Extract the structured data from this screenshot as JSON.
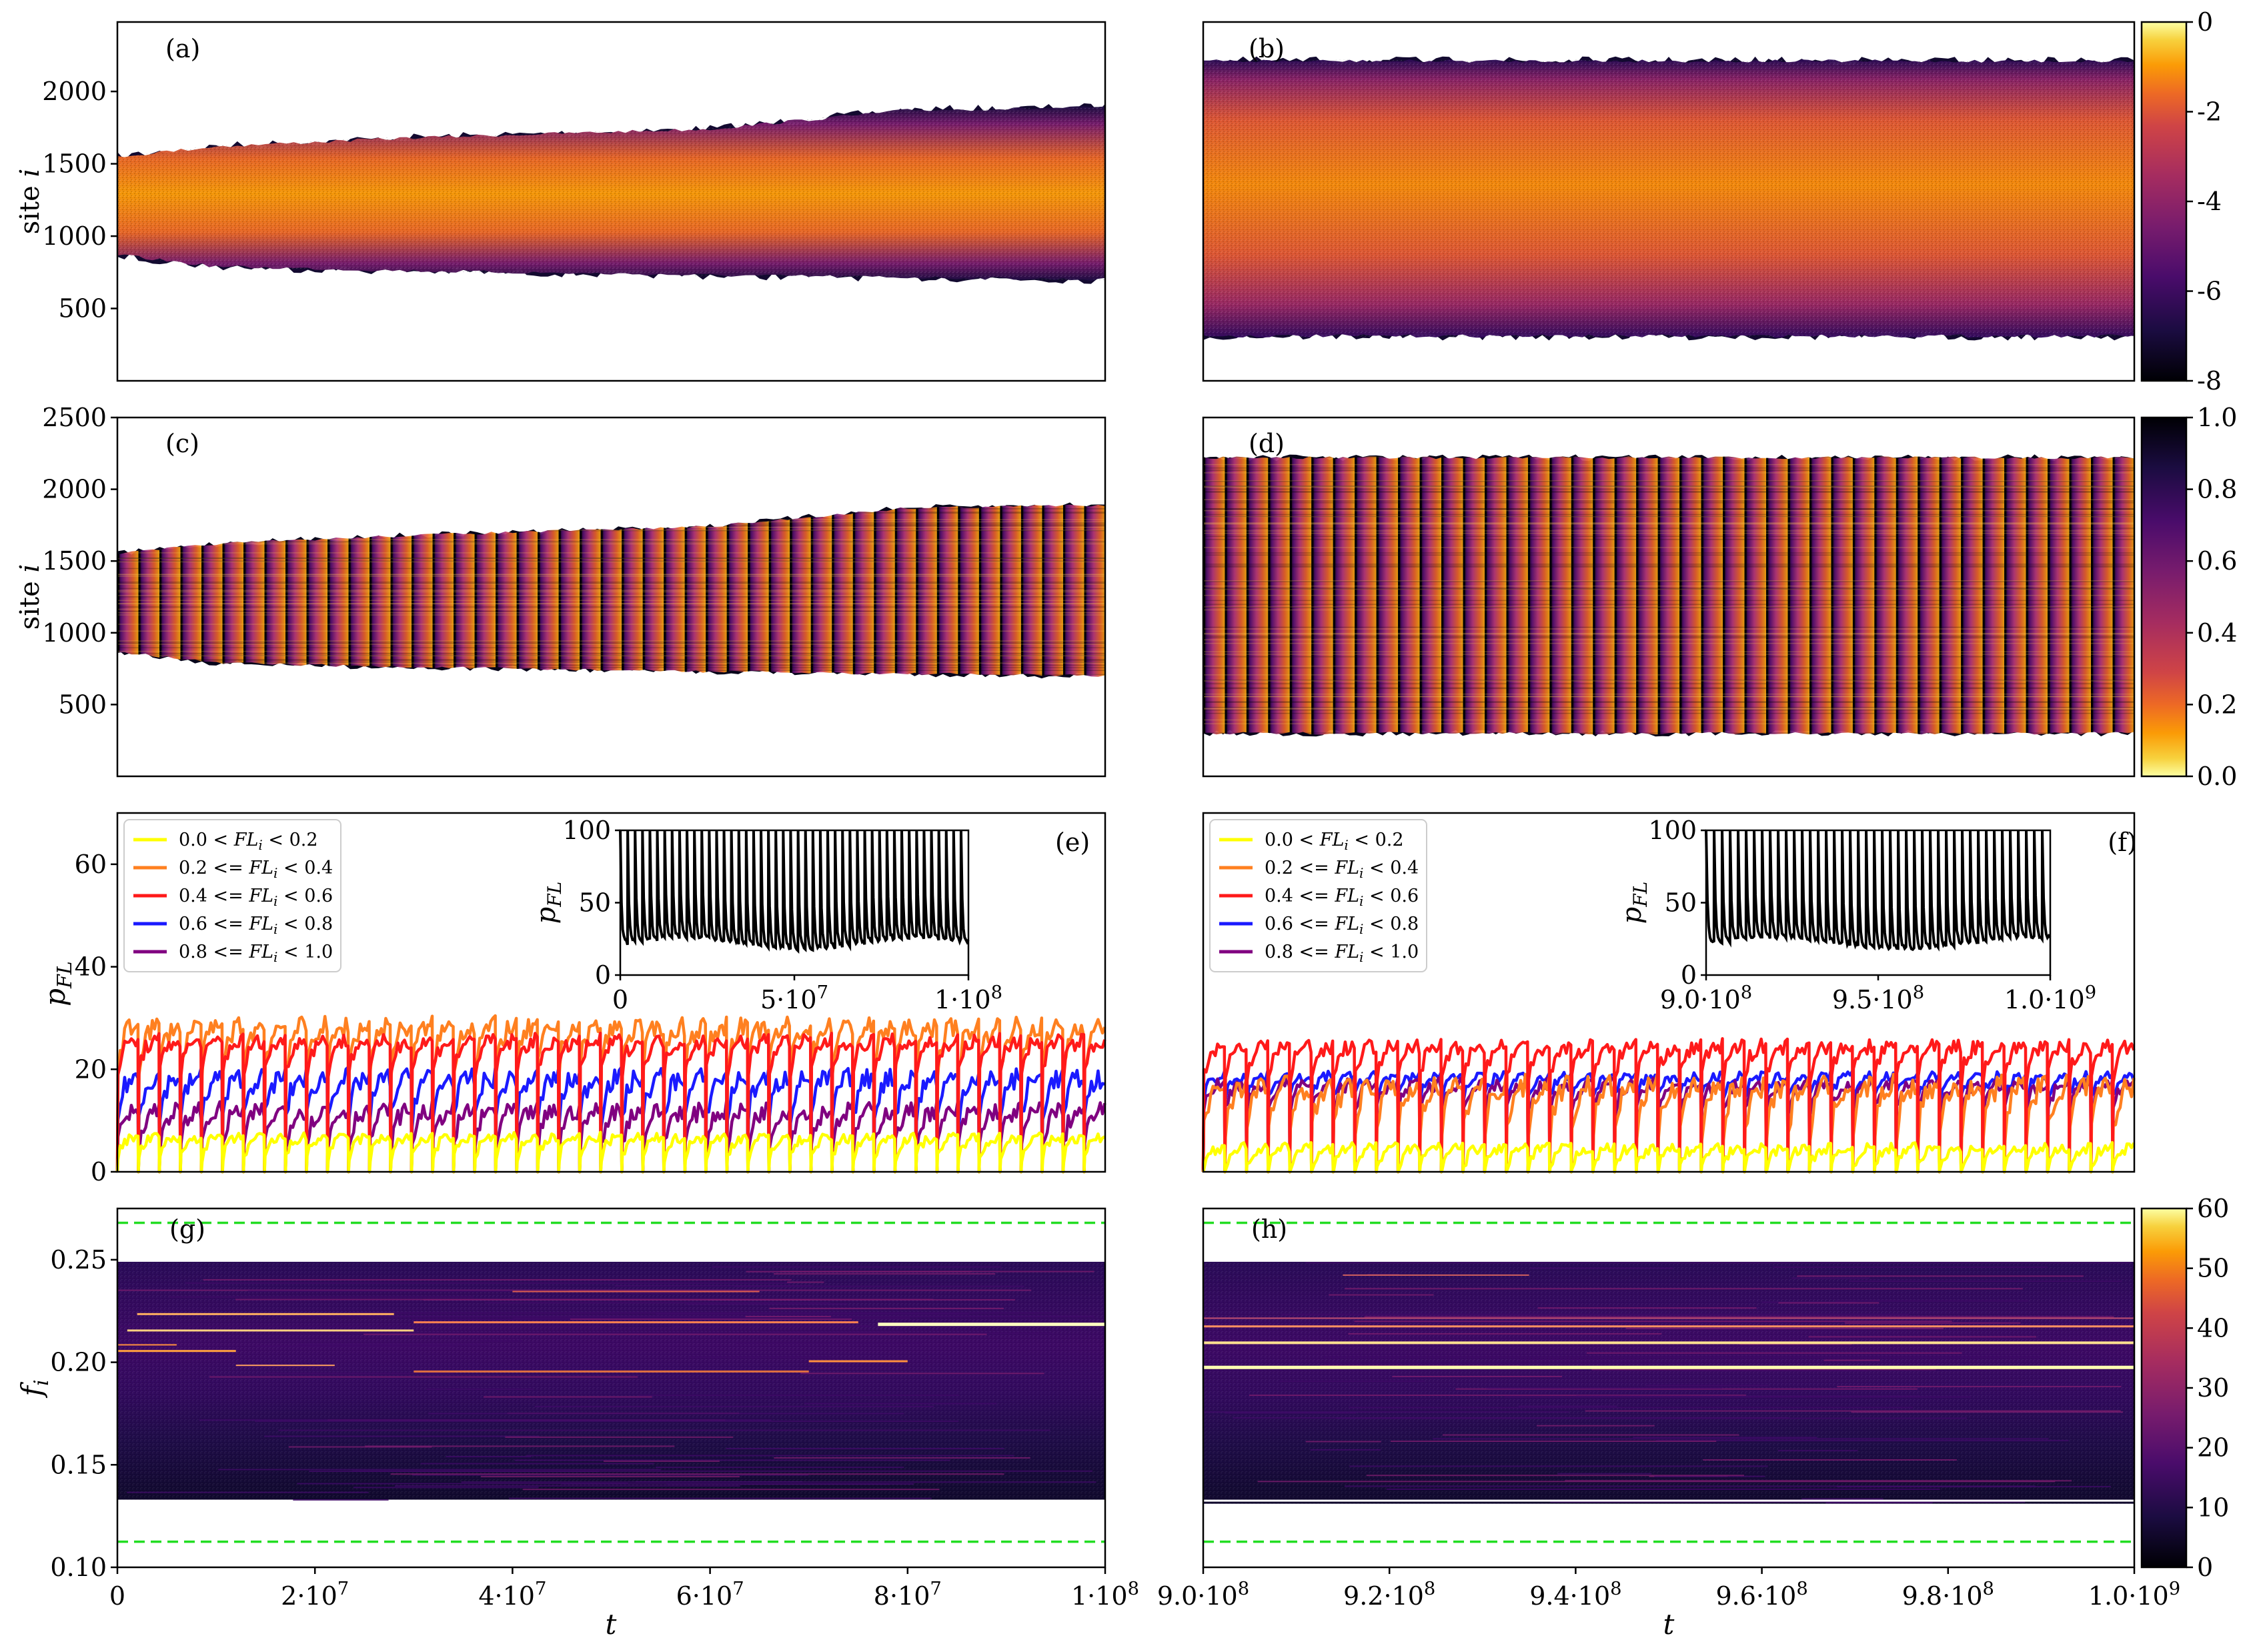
{
  "chart_data": [
    {
      "id": "a",
      "panel_label": "(a)",
      "type": "heatmap",
      "ylabel": "site i",
      "xlim": [
        0,
        100000000
      ],
      "ylim": [
        0,
        2480
      ],
      "yticks": [
        "2000",
        "1500",
        "1000",
        "500"
      ],
      "ytick_values": [
        2000,
        1500,
        1000,
        500
      ],
      "band_lower": [
        [
          0,
          870
        ],
        [
          10000000,
          790
        ],
        [
          30000000,
          760
        ],
        [
          60000000,
          730
        ],
        [
          100000000,
          700
        ]
      ],
      "band_upper": [
        [
          0,
          1550
        ],
        [
          10000000,
          1620
        ],
        [
          30000000,
          1680
        ],
        [
          60000000,
          1740
        ],
        [
          80000000,
          1870
        ],
        [
          100000000,
          1890
        ]
      ]
    },
    {
      "id": "b",
      "panel_label": "(b)",
      "type": "heatmap",
      "xlim": [
        900000000,
        1000000000
      ],
      "ylim": [
        0,
        2480
      ],
      "band_lower": [
        [
          900000000,
          310
        ],
        [
          1000000000,
          310
        ]
      ],
      "band_upper": [
        [
          900000000,
          2210
        ],
        [
          1000000000,
          2210
        ]
      ],
      "colorbar": {
        "range": [
          -8,
          0
        ],
        "ticks": [
          "0",
          "-2",
          "-4",
          "-6",
          "-8"
        ],
        "tick_values": [
          0,
          -2,
          -4,
          -6,
          -8
        ]
      }
    },
    {
      "id": "c",
      "panel_label": "(c)",
      "type": "heatmap",
      "ylabel": "site i",
      "xlim": [
        0,
        100000000
      ],
      "ylim": [
        0,
        2500
      ],
      "yticks": [
        "2500",
        "2000",
        "1500",
        "1000",
        "500"
      ],
      "ytick_values": [
        2500,
        2000,
        1500,
        1000,
        500
      ],
      "band_lower": [
        [
          0,
          870
        ],
        [
          10000000,
          790
        ],
        [
          30000000,
          760
        ],
        [
          60000000,
          730
        ],
        [
          100000000,
          700
        ]
      ],
      "band_upper": [
        [
          0,
          1550
        ],
        [
          10000000,
          1620
        ],
        [
          30000000,
          1680
        ],
        [
          60000000,
          1740
        ],
        [
          80000000,
          1870
        ],
        [
          100000000,
          1890
        ]
      ],
      "stripe_count": 47
    },
    {
      "id": "d",
      "panel_label": "(d)",
      "type": "heatmap",
      "xlim": [
        900000000,
        1000000000
      ],
      "ylim": [
        0,
        2500
      ],
      "band_lower": [
        [
          900000000,
          300
        ],
        [
          1000000000,
          300
        ]
      ],
      "band_upper": [
        [
          900000000,
          2220
        ],
        [
          1000000000,
          2220
        ]
      ],
      "stripe_count": 43,
      "colorbar": {
        "range": [
          0,
          1
        ],
        "ticks": [
          "1.0",
          "0.8",
          "0.6",
          "0.4",
          "0.2",
          "0.0"
        ],
        "tick_values": [
          1.0,
          0.8,
          0.6,
          0.4,
          0.2,
          0.0
        ]
      }
    },
    {
      "id": "e",
      "panel_label": "(e)",
      "type": "line",
      "ylabel": "p_FL",
      "xlim": [
        0,
        100000000
      ],
      "ylim": [
        0,
        70
      ],
      "yticks": [
        "60",
        "40",
        "20",
        "0"
      ],
      "ytick_values": [
        60,
        40,
        20,
        0
      ],
      "cycles": 47,
      "series": [
        {
          "name": "0.0 < FL_i < 0.2",
          "color": "#ffff00",
          "base": 5,
          "amp": 4
        },
        {
          "name": "0.2 <= FL_i < 0.4",
          "color": "#ff8020",
          "base": 25,
          "amp": 8
        },
        {
          "name": "0.4 <= FL_i < 0.6",
          "color": "#ff1a1a",
          "base": 23,
          "amp": 6
        },
        {
          "name": "0.6 <= FL_i < 0.8",
          "color": "#1a1aff",
          "base": 15,
          "amp": 8
        },
        {
          "name": "0.8 <= FL_i < 1.0",
          "color": "#800080",
          "base": 9,
          "amp": 7
        }
      ],
      "inset": {
        "ylabel": "p_FL",
        "xlim": [
          0,
          100000000
        ],
        "ylim": [
          0,
          100
        ],
        "xticks": [
          "0",
          "5·10^7",
          "1·10^8"
        ],
        "xtick_values": [
          0,
          50000000,
          100000000
        ],
        "yticks": [
          "100",
          "50",
          "0"
        ],
        "ytick_values": [
          100,
          50,
          0
        ],
        "cycles": 47,
        "floor": 22,
        "peak": 100,
        "color": "#000000"
      }
    },
    {
      "id": "f",
      "panel_label": "(f)",
      "type": "line",
      "xlim": [
        900000000,
        1000000000
      ],
      "ylim": [
        0,
        70
      ],
      "cycles": 43,
      "series": [
        {
          "name": "0.0 < FL_i < 0.2",
          "color": "#ffff00",
          "base": 3,
          "amp": 4
        },
        {
          "name": "0.2 <= FL_i < 0.4",
          "color": "#ff8020",
          "base": 13,
          "amp": 9
        },
        {
          "name": "0.4 <= FL_i < 0.6",
          "color": "#ff1a1a",
          "base": 22,
          "amp": 6
        },
        {
          "name": "0.6 <= FL_i < 0.8",
          "color": "#1a1aff",
          "base": 17,
          "amp": 4
        },
        {
          "name": "0.8 <= FL_i < 1.0",
          "color": "#800080",
          "base": 15,
          "amp": 5
        }
      ],
      "inset": {
        "ylabel": "p_FL",
        "xlim": [
          900000000,
          1000000000
        ],
        "ylim": [
          0,
          100
        ],
        "xticks": [
          "9.0·10^8",
          "9.5·10^8",
          "1.0·10^9"
        ],
        "xtick_values": [
          900000000,
          950000000,
          1000000000
        ],
        "yticks": [
          "100",
          "50",
          "0"
        ],
        "ytick_values": [
          100,
          50,
          0
        ],
        "cycles": 43,
        "floor": 22,
        "peak": 100,
        "color": "#000000"
      }
    },
    {
      "id": "g",
      "panel_label": "(g)",
      "type": "heatmap",
      "ylabel": "f_i",
      "xlabel": "t",
      "xlim": [
        0,
        100000000
      ],
      "ylim": [
        0.1,
        0.275
      ],
      "yticks": [
        "0.25",
        "0.20",
        "0.15",
        "0.10"
      ],
      "ytick_values": [
        0.25,
        0.2,
        0.15,
        0.1
      ],
      "xticks": [
        "0",
        "2·10^7",
        "4·10^7",
        "6·10^7",
        "8·10^7",
        "1·10^8"
      ],
      "xtick_values": [
        0,
        20000000,
        40000000,
        60000000,
        80000000,
        100000000
      ],
      "data_band": [
        0.133,
        0.249
      ],
      "guide_lines": [
        0.268,
        0.1125
      ],
      "guide_color": "#22dd22",
      "bright_lines": [
        {
          "f": 0.2185,
          "x0": 77000000,
          "x1": 100000000,
          "color": "#ffffc0",
          "w": 5
        },
        {
          "f": 0.2235,
          "x0": 2000000,
          "x1": 28000000,
          "color": "#ffb060",
          "w": 3
        },
        {
          "f": 0.2155,
          "x0": 1000000,
          "x1": 30000000,
          "color": "#ffd080",
          "w": 3
        },
        {
          "f": 0.2195,
          "x0": 30000000,
          "x1": 75000000,
          "color": "#ff8050",
          "w": 3
        },
        {
          "f": 0.2005,
          "x0": 70000000,
          "x1": 80000000,
          "color": "#ff9040",
          "w": 3
        },
        {
          "f": 0.1955,
          "x0": 30000000,
          "x1": 70000000,
          "color": "#e07040",
          "w": 3
        },
        {
          "f": 0.2345,
          "x0": 40000000,
          "x1": 65000000,
          "color": "#e06050",
          "w": 2
        },
        {
          "f": 0.2055,
          "x0": 0,
          "x1": 12000000,
          "color": "#ffa040",
          "w": 3
        },
        {
          "f": 0.2085,
          "x0": 0,
          "x1": 6000000,
          "color": "#ff9040",
          "w": 2
        },
        {
          "f": 0.1985,
          "x0": 12000000,
          "x1": 22000000,
          "color": "#ffa060",
          "w": 2
        }
      ]
    },
    {
      "id": "h",
      "panel_label": "(h)",
      "type": "heatmap",
      "xlabel": "t",
      "xlim": [
        900000000,
        1000000000
      ],
      "ylim": [
        0.1,
        0.275
      ],
      "xticks": [
        "9.0·10^8",
        "9.2·10^8",
        "9.4·10^8",
        "9.6·10^8",
        "9.8·10^8",
        "1.0·10^9"
      ],
      "xtick_values": [
        900000000,
        920000000,
        940000000,
        960000000,
        980000000,
        1000000000
      ],
      "data_band": [
        0.131,
        0.249
      ],
      "guide_lines": [
        0.268,
        0.1125
      ],
      "guide_color": "#22dd22",
      "bright_lines": [
        {
          "f": 0.1975,
          "x0": 900000000,
          "x1": 1000000000,
          "color": "#ffffb0",
          "w": 5
        },
        {
          "f": 0.2095,
          "x0": 900000000,
          "x1": 1000000000,
          "color": "#ffe090",
          "w": 4
        },
        {
          "f": 0.2175,
          "x0": 900000000,
          "x1": 1000000000,
          "color": "#ff9060",
          "w": 3
        },
        {
          "f": 0.2215,
          "x0": 900000000,
          "x1": 1000000000,
          "color": "#c05070",
          "w": 2
        },
        {
          "f": 0.2425,
          "x0": 915000000,
          "x1": 935000000,
          "color": "#d06060",
          "w": 2
        },
        {
          "f": 0.1325,
          "x0": 900000000,
          "x1": 1000000000,
          "color": "#ffffff",
          "w": 3
        }
      ],
      "colorbar": {
        "range": [
          0,
          60
        ],
        "ticks": [
          "60",
          "50",
          "40",
          "30",
          "20",
          "10",
          "0"
        ],
        "tick_values": [
          60,
          50,
          40,
          30,
          20,
          10,
          0
        ]
      }
    }
  ]
}
